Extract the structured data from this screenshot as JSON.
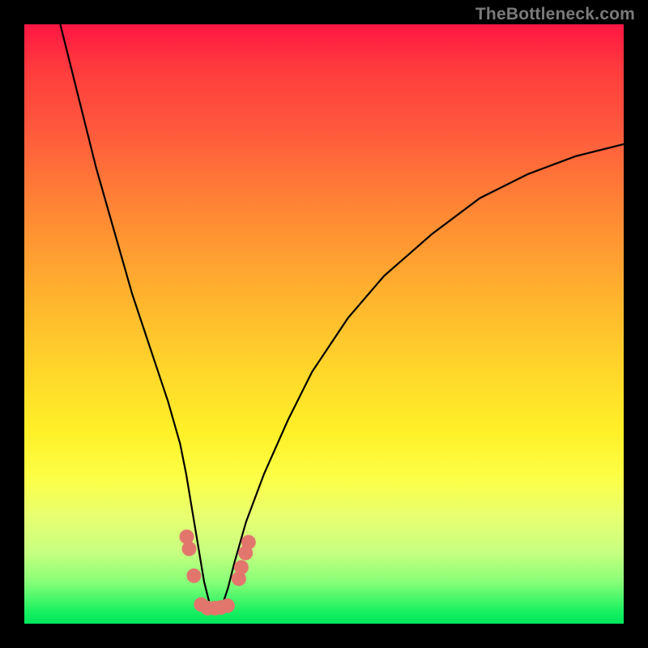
{
  "watermark": "TheBottleneck.com",
  "colors": {
    "frame": "#000000",
    "gradient_top": "#ff1744",
    "gradient_mid": "#fff028",
    "gradient_bottom": "#00e45c",
    "curve": "#000000",
    "marker": "#e2766d"
  },
  "chart_data": {
    "type": "line",
    "title": "",
    "xlabel": "",
    "ylabel": "",
    "xlim": [
      0,
      100
    ],
    "ylim": [
      0,
      100
    ],
    "series": [
      {
        "name": "bottleneck-curve",
        "x": [
          6,
          8,
          10,
          12,
          14,
          16,
          18,
          20,
          22,
          24,
          26,
          27,
          28,
          29,
          30,
          31,
          32,
          33,
          34,
          35,
          37,
          40,
          44,
          48,
          54,
          60,
          68,
          76,
          84,
          92,
          100
        ],
        "y": [
          100,
          92,
          84,
          76,
          69,
          62,
          55,
          49,
          43,
          37,
          30,
          25,
          19,
          13,
          7,
          3,
          2,
          3,
          6,
          10,
          17,
          25,
          34,
          42,
          51,
          58,
          65,
          71,
          75,
          78,
          80
        ]
      }
    ],
    "markers": {
      "name": "highlight-points",
      "points": [
        {
          "x": 27.1,
          "y": 14.5
        },
        {
          "x": 27.5,
          "y": 12.5
        },
        {
          "x": 28.3,
          "y": 8.0
        },
        {
          "x": 29.5,
          "y": 3.2
        },
        {
          "x": 30.6,
          "y": 2.6
        },
        {
          "x": 31.8,
          "y": 2.6
        },
        {
          "x": 32.8,
          "y": 2.7
        },
        {
          "x": 33.9,
          "y": 3.0
        },
        {
          "x": 35.8,
          "y": 7.5
        },
        {
          "x": 36.2,
          "y": 9.4
        },
        {
          "x": 36.9,
          "y": 11.8
        },
        {
          "x": 37.4,
          "y": 13.6
        }
      ]
    },
    "annotations": [],
    "legend": false,
    "grid": false
  }
}
